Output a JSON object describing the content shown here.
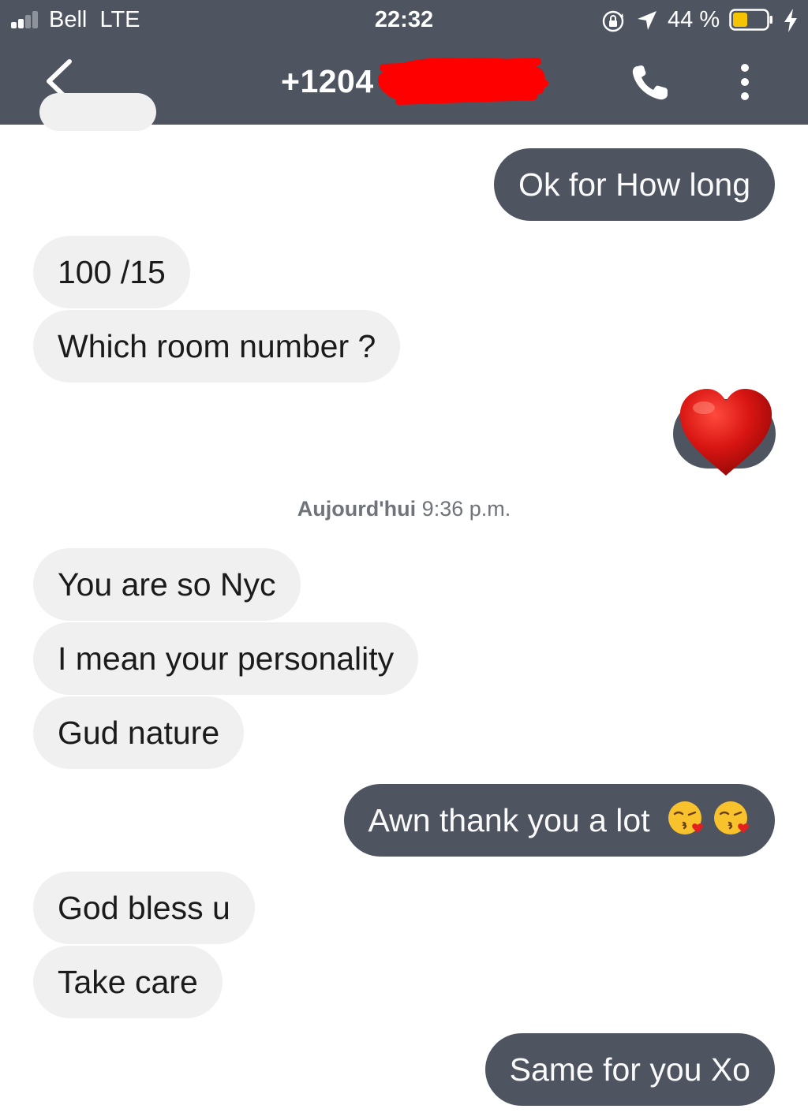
{
  "status_bar": {
    "carrier": "Bell",
    "network": "LTE",
    "time": "22:32",
    "battery_percent": "44 %",
    "battery_level": 0.44
  },
  "header": {
    "contact": "+1204",
    "back_icon": "chevron-left-icon",
    "call_icon": "phone-icon",
    "menu_icon": "more-vertical-icon"
  },
  "messages": [
    {
      "from": "me",
      "text": "Ok for How long"
    },
    {
      "from": "them",
      "text": "100 /15"
    },
    {
      "from": "them",
      "text": "Which room number ?"
    },
    {
      "from": "me",
      "emoji": "heart"
    },
    {
      "from": "them",
      "text": "You are so Nyc"
    },
    {
      "from": "them",
      "text": "I mean your personality"
    },
    {
      "from": "them",
      "text": "Gud nature"
    },
    {
      "from": "me",
      "text": "Awn thank you a lot"
    },
    {
      "from": "them",
      "text": "God bless u"
    },
    {
      "from": "them",
      "text": "Take care"
    },
    {
      "from": "me",
      "text": "Same for you Xo"
    }
  ],
  "timestamp": {
    "day": "Aujourd'hui",
    "time": "9:36 p.m."
  },
  "colors": {
    "header_bg": "#4e5460",
    "outgoing_bubble": "#4e5460",
    "incoming_bubble": "#f0f0f0",
    "battery_fill": "#f5c400",
    "redaction": "#ff0000"
  }
}
